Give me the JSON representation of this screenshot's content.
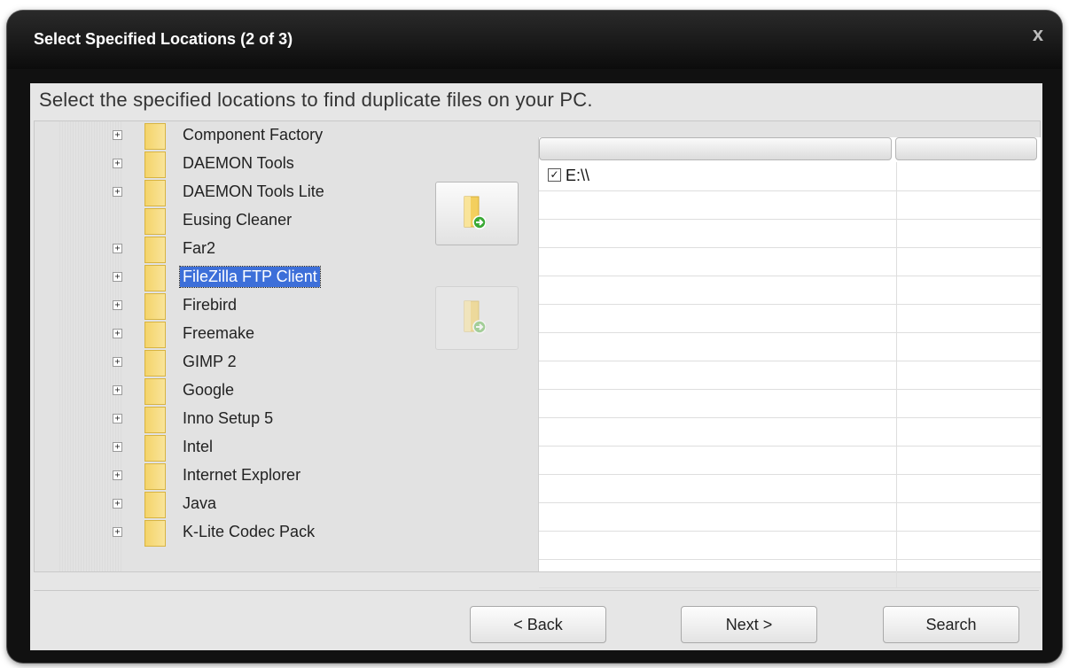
{
  "window": {
    "title": "Select Specified Locations (2 of 3)",
    "close_glyph": "x"
  },
  "instruction": "Select the specified locations to find duplicate files on your PC.",
  "tree": {
    "items": [
      {
        "label": "Component Factory",
        "expandable": true,
        "selected": false
      },
      {
        "label": "DAEMON Tools",
        "expandable": true,
        "selected": false
      },
      {
        "label": "DAEMON Tools Lite",
        "expandable": true,
        "selected": false
      },
      {
        "label": "Eusing Cleaner",
        "expandable": false,
        "selected": false
      },
      {
        "label": "Far2",
        "expandable": true,
        "selected": false
      },
      {
        "label": "FileZilla FTP Client",
        "expandable": true,
        "selected": true
      },
      {
        "label": "Firebird",
        "expandable": true,
        "selected": false
      },
      {
        "label": "Freemake",
        "expandable": true,
        "selected": false
      },
      {
        "label": "GIMP 2",
        "expandable": true,
        "selected": false
      },
      {
        "label": "Google",
        "expandable": true,
        "selected": false
      },
      {
        "label": "Inno Setup 5",
        "expandable": true,
        "selected": false
      },
      {
        "label": "Intel",
        "expandable": true,
        "selected": false
      },
      {
        "label": "Internet Explorer",
        "expandable": true,
        "selected": false
      },
      {
        "label": "Java",
        "expandable": true,
        "selected": false
      },
      {
        "label": "K-Lite Codec Pack",
        "expandable": true,
        "selected": false
      }
    ],
    "expander_glyph": "+",
    "folder_icon": "folder-icon"
  },
  "transfer": {
    "add_icon": "add-folder-icon",
    "remove_icon": "remove-folder-icon"
  },
  "selected_list": {
    "columns": [
      "",
      ""
    ],
    "rows": [
      {
        "checked": true,
        "path": "E:\\\\"
      }
    ],
    "check_glyph": "✓"
  },
  "buttons": {
    "back": "< Back",
    "next": "Next >",
    "search": "Search"
  },
  "colors": {
    "selection": "#3d6fd9",
    "titlebar": "#111111"
  }
}
